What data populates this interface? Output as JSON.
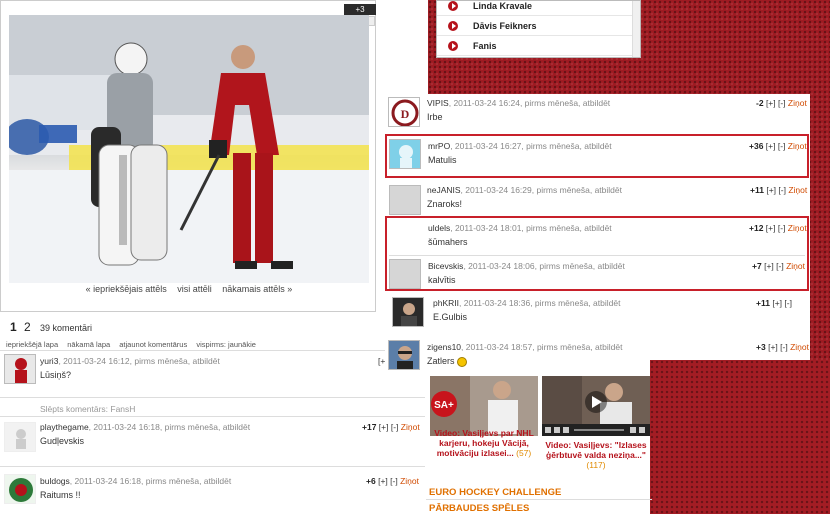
{
  "photo": {
    "score": "+3",
    "plus": "+",
    "minus": "-",
    "nav_prev": "« iepriekšējais attēls",
    "nav_all": "visi attēli",
    "nav_next": "nākamais attēls »"
  },
  "dropdown": {
    "items": [
      "Linda Kravale",
      "Dāvis Feikners",
      "Fanis"
    ]
  },
  "comments_right": [
    {
      "user": "VIPIS",
      "meta": ", 2011-03-24 16:24, pirms mēneša, atbildēt",
      "text": "Irbe",
      "score": "-2",
      "ctrl": "[+] [-]",
      "report": "Ziņot"
    },
    {
      "user": "mrPO",
      "meta": ", 2011-03-24 16:27, pirms mēneša, atbildēt",
      "text": "Matulis",
      "score": "+36",
      "ctrl": "[+] [-]",
      "report": "Ziņot"
    },
    {
      "user": "neJANIS",
      "meta": ", 2011-03-24 16:29, pirms mēneša, atbildēt",
      "text": "Znaroks!",
      "score": "+11",
      "ctrl": "[+] [-]",
      "report": "Ziņot"
    },
    {
      "user": "uldels",
      "meta": ", 2011-03-24 18:01, pirms mēneša, atbildēt",
      "text": "šūmahers",
      "score": "+12",
      "ctrl": "[+] [-]",
      "report": "Ziņot"
    },
    {
      "user": "Bicevskis",
      "meta": ", 2011-03-24 18:06, pirms mēneša, atbildēt",
      "text": "kalvītis",
      "score": "+7",
      "ctrl": "[+] [-]",
      "report": "Ziņot"
    },
    {
      "user": "phKRII",
      "meta": ", 2011-03-24 18:36, pirms mēneša, atbildēt",
      "text": "E.Gulbis",
      "score": "+11",
      "ctrl": "[+] [-]",
      "report": ""
    },
    {
      "user": "zigens10",
      "meta": ", 2011-03-24 18:57, pirms mēneša, atbildēt",
      "text": "Zatlers",
      "score": "+3",
      "ctrl": "[+] [-]",
      "report": "Ziņot"
    }
  ],
  "pager": {
    "page1": "1",
    "page2": "2",
    "count": "39 komentāri",
    "links": [
      "iepriekšējā lapa",
      "nākamā lapa",
      "atjaunot komentārus",
      "vispirms: jaunākie"
    ]
  },
  "comments_left": [
    {
      "user": "yuri3",
      "meta": ", 2011-03-24 16:12, pirms mēneša, atbildēt",
      "text": "Lūsiņš?",
      "score": "",
      "ctrl": "[+] [-]",
      "report": ""
    },
    {
      "hidden": "Slēpts komentārs: FansH"
    },
    {
      "user": "playthegame",
      "meta": ", 2011-03-24 16:18, pirms mēneša, atbildēt",
      "text": "Gudļevskis",
      "score": "+17",
      "ctrl": "[+] [-]",
      "report": "Ziņot"
    },
    {
      "user": "buldogs",
      "meta": ", 2011-03-24 16:18, pirms mēneša, atbildēt",
      "text": "Raitums !!",
      "score": "+6",
      "ctrl": "[+] [-]",
      "report": "Ziņot"
    }
  ],
  "videos": [
    {
      "caption": "Video: Vasiļjevs par NHL karjeru, hokeju Vācijā, motivāciju izlasei...",
      "count": "(57)"
    },
    {
      "caption": "Video: Vasiļjevs: \"Izlases ģērbtuvē valda neziņa...\"",
      "count": "(117)"
    }
  ],
  "sections": {
    "euro": "EURO HOCKEY CHALLENGE",
    "parbaudes": "PĀRBAUDES SPĒLES"
  },
  "colors": {
    "accent": "#b5121b",
    "report": "#d04a00",
    "jersey": "#9e1b22"
  }
}
